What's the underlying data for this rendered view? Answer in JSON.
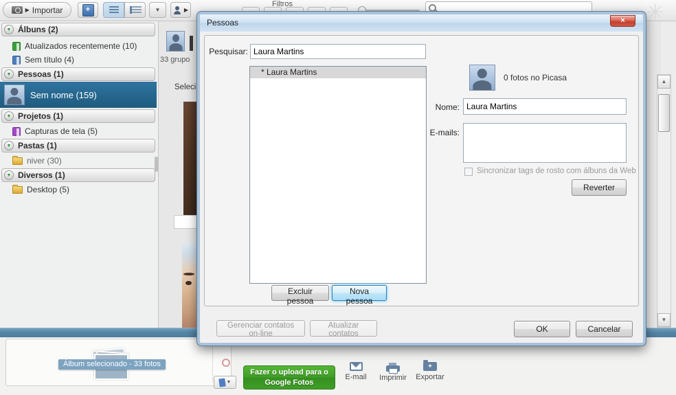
{
  "toolbar": {
    "import_label": "Importar",
    "filters_label": "Filtros",
    "search_value": ""
  },
  "sidebar": {
    "rows": [
      {
        "label": "Álbuns (2)"
      },
      {
        "label": "Atualizados recentemente (10)"
      },
      {
        "label": "Sem título (4)"
      },
      {
        "label": "Pessoas (1)"
      },
      {
        "label": "Sem nome (159)"
      },
      {
        "label": "Projetos (1)"
      },
      {
        "label": "Capturas de tela (5)"
      },
      {
        "label": "Pastas (1)"
      },
      {
        "label": "niver (30)"
      },
      {
        "label": "Diversos (1)"
      },
      {
        "label": "Desktop (5)"
      }
    ]
  },
  "content": {
    "group_count_text": "33 grupo",
    "select_text": "Selecio"
  },
  "dialog": {
    "title": "Pessoas",
    "close_glyph": "×",
    "search_label": "Pesquisar:",
    "search_value": "Laura Martins",
    "list_items": [
      "* Laura Martins"
    ],
    "photo_count_text": "0 fotos no Picasa",
    "name_label": "Nome:",
    "name_value": "Laura Martins",
    "emails_label": "E-mails:",
    "emails_value": "",
    "sync_checkbox_label": "Sincronizar tags de rosto com álbuns da Web",
    "revert_button": "Reverter",
    "delete_button": "Excluir pessoa",
    "new_button": "Nova pessoa",
    "manage_contacts_button": "Gerenciar contatos on-line",
    "update_contacts_button": "Atualizar contatos",
    "ok_button": "OK",
    "cancel_button": "Cancelar"
  },
  "tray": {
    "album_badge": "Álbum selecionado - 33 fotos",
    "upload_line1": "Fazer o upload para o",
    "upload_line2": "Google Fotos",
    "email_label": "E-mail",
    "print_label": "Imprimir",
    "export_label": "Exportar"
  },
  "colors": {
    "selected_row_blue": "#2e74a0",
    "bar_blue": "#5586a6",
    "badge_blue": "#7ca3c0",
    "upload_green": "#3f9e27",
    "close_red": "#c43f2f"
  }
}
